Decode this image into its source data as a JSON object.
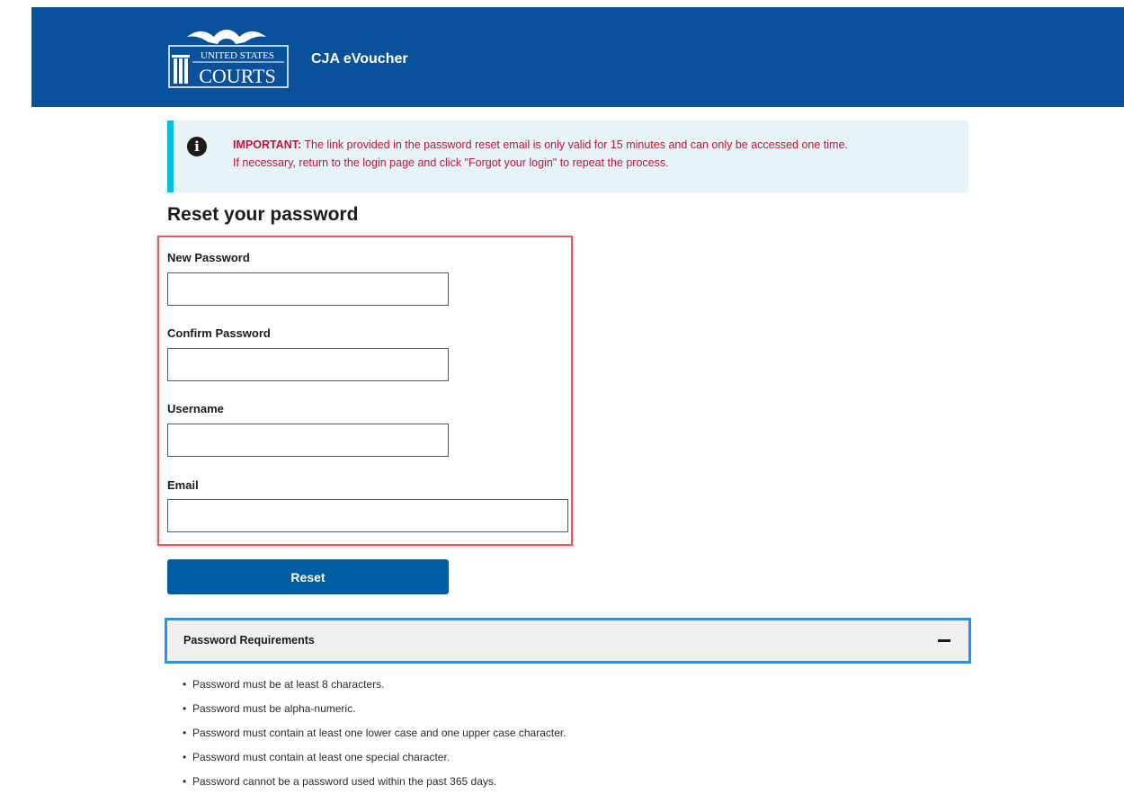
{
  "header": {
    "logo": {
      "line1": "UNITED STATES",
      "line2": "COURTS"
    },
    "app_title": "CJA eVoucher"
  },
  "alert": {
    "icon": "info-icon",
    "label": "IMPORTANT:",
    "message_line1": " The link provided in the password reset email is only valid for 15 minutes and can only be accessed one time.",
    "message_line2": "If necessary, return to the login page and click \"Forgot your login\" to repeat the process."
  },
  "page_title": "Reset your password",
  "form": {
    "fields": [
      {
        "label": "New Password",
        "value": "",
        "placeholder": ""
      },
      {
        "label": "Confirm Password",
        "value": "",
        "placeholder": ""
      },
      {
        "label": "Username",
        "value": "",
        "placeholder": ""
      },
      {
        "label": "Email",
        "value": "",
        "placeholder": ""
      }
    ],
    "reset_label": "Reset"
  },
  "requirements": {
    "title": "Password Requirements",
    "toggle_icon": "minus-icon",
    "items": [
      "Password must be at least 8 characters.",
      "Password must be alpha-numeric.",
      "Password must contain at least one lower case and one upper case character.",
      "Password must contain at least one special character.",
      "Password cannot be a password used within the past 365 days."
    ]
  },
  "colors": {
    "header_bg": "#0a519c",
    "alert_bg": "#e6f4f8",
    "alert_border": "#00bde3",
    "alert_text": "#c0133a",
    "button_bg": "#005ea2",
    "focus_border": "#2491ff",
    "highlight_border": "#e35b5b"
  }
}
